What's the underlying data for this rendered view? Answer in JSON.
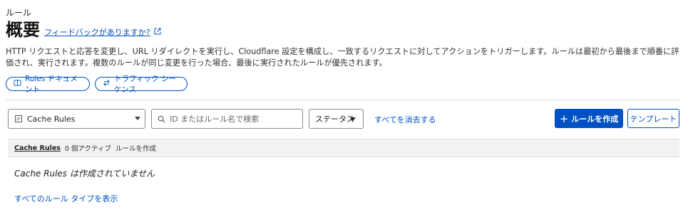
{
  "breadcrumb": "ルール",
  "page_title": "概要",
  "feedback_link": "フィードバックがありますか?",
  "description": "HTTP リクエストと応答を変更し、URL リダイレクトを実行し、Cloudflare 設定を構成し、一致するリクエストに対してアクションをトリガーします。ルールは最初から最後まで順番に評価され、実行されます。複数のルールが同じ変更を行った場合、最後に実行されたルールが優先されます。",
  "doc_buttons": {
    "rules_docs": "Rules ドキュメント",
    "traffic_sequence": "トラフィック シーケンス"
  },
  "filters": {
    "rule_type_selected": "Cache Rules",
    "search_placeholder": "ID またはルール名で検索",
    "status_label": "ステータス",
    "clear_all": "すべてを消去する"
  },
  "actions": {
    "create_rule": "ルールを作成",
    "create_rule_icon": "+",
    "templates": "テンプレート"
  },
  "table": {
    "section_name": "Cache Rules",
    "active_count": "0 個アクティブ",
    "create_link": "ルールを作成"
  },
  "empty_state": "Cache Rules は作成されていません",
  "show_all_types": "すべてのルール タイプを表示",
  "colors": {
    "accent": "#0051c3",
    "text": "#1e1e1e",
    "divider": "#d9d9d9",
    "table_header_bg": "#f2f2f2"
  },
  "icons": {
    "external_link": "external-link-icon",
    "book": "book-icon",
    "swap": "swap-arrows-icon",
    "rule_type": "rule-type-icon",
    "search": "search-icon",
    "caret": "caret-down-icon",
    "plus": "plus-icon"
  }
}
